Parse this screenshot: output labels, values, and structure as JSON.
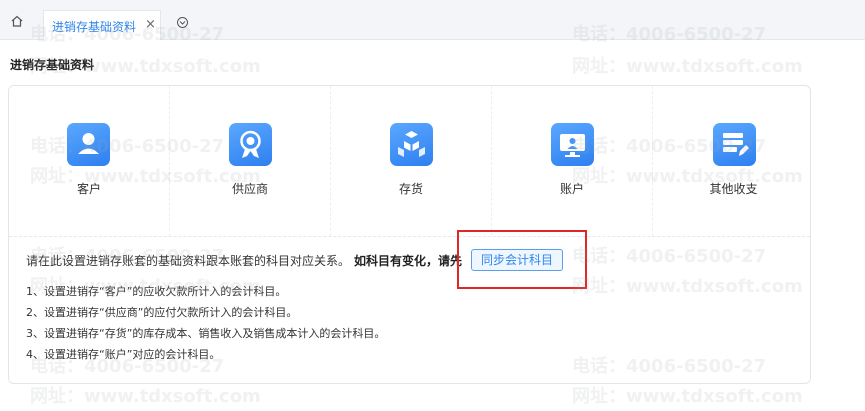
{
  "tabs": {
    "active_label": "进销存基础资料",
    "close_glyph": "×"
  },
  "page": {
    "title": "进销存基础资料"
  },
  "modules": [
    {
      "label": "客户",
      "icon": "customer-icon"
    },
    {
      "label": "供应商",
      "icon": "supplier-icon"
    },
    {
      "label": "存货",
      "icon": "inventory-icon"
    },
    {
      "label": "账户",
      "icon": "account-icon"
    },
    {
      "label": "其他收支",
      "icon": "other-income-expense-icon"
    }
  ],
  "notice": {
    "text": "请在此设置进销存账套的基础资料跟本账套的科目对应关系。",
    "bold": "如科目有变化，请先",
    "sync_button": "同步会计科目"
  },
  "steps": [
    "1、设置进销存“客户”的应收欠款所计入的会计科目。",
    "2、设置进销存“供应商”的应付欠款所计入的会计科目。",
    "3、设置进销存“存货”的库存成本、销售收入及销售成本计入的会计科目。",
    "4、设置进销存“账户”对应的会计科目。"
  ],
  "watermark": {
    "phone": "电话：4006-6500-27",
    "site": "网址：www.tdxsoft.com"
  },
  "colors": {
    "accent": "#2f86ea",
    "icon_gradient_start": "#5aa8ff",
    "icon_gradient_end": "#2e7ff0",
    "highlight": "#e02727"
  }
}
